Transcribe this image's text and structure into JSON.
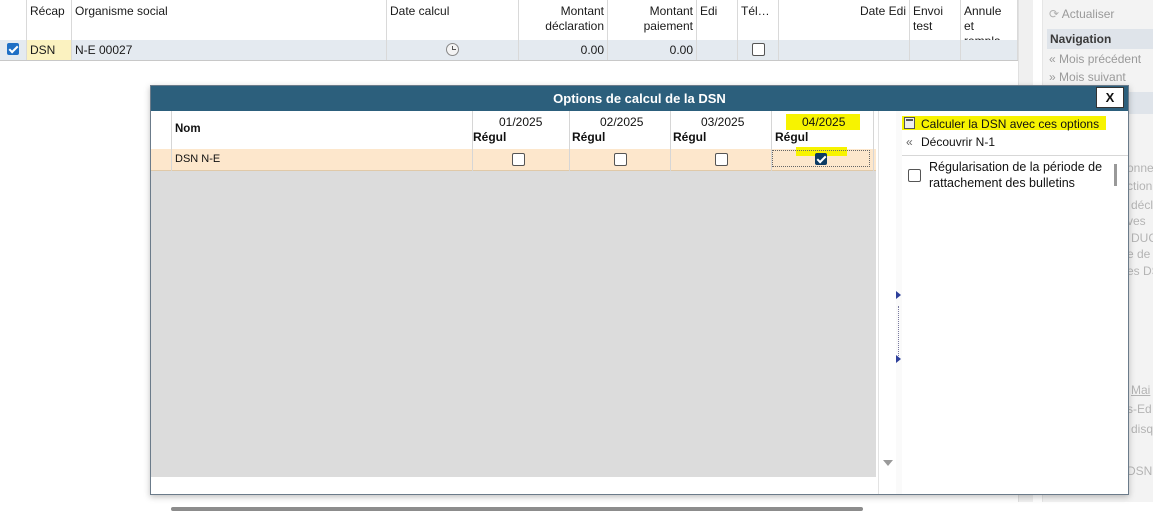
{
  "background_grid": {
    "columns": [
      "Récap",
      "Organisme social",
      "Date calcul",
      "Montant déclaration",
      "Montant paiement",
      "Edi",
      "Tél…",
      "Date Edi",
      "Envoi test",
      "Annule et rempla…"
    ],
    "row": {
      "recap": "DSN",
      "organisme": "N-E  00027",
      "montant_declaration": "0.00",
      "montant_paiement": "0.00"
    }
  },
  "right_panel": {
    "actualiser": "Actualiser",
    "navigation_header": "Navigation",
    "mois_precedent": "Mois précédent",
    "mois_suivant": "Mois suivant",
    "fragments": [
      "onne",
      "ction",
      "décl",
      "ves",
      "DUC",
      "e de D",
      "es DS",
      "Mai",
      "s-Ed",
      "disqu",
      "DSN"
    ]
  },
  "dialog": {
    "title": "Options de calcul de la DSN",
    "close_label": "X",
    "grid": {
      "nom_header": "Nom",
      "months": [
        "01/2025",
        "02/2025",
        "03/2025",
        "04/2025"
      ],
      "sub_header": "Régul",
      "row_name": "DSN N-E",
      "checks": [
        false,
        false,
        false,
        true
      ]
    },
    "options": {
      "calculer": "Calculer la DSN avec ces options",
      "decouvrir": "Découvrir N-1",
      "regularisation": "Régularisation de la période de rattachement des bulletins",
      "regularisation_checked": false
    }
  }
}
